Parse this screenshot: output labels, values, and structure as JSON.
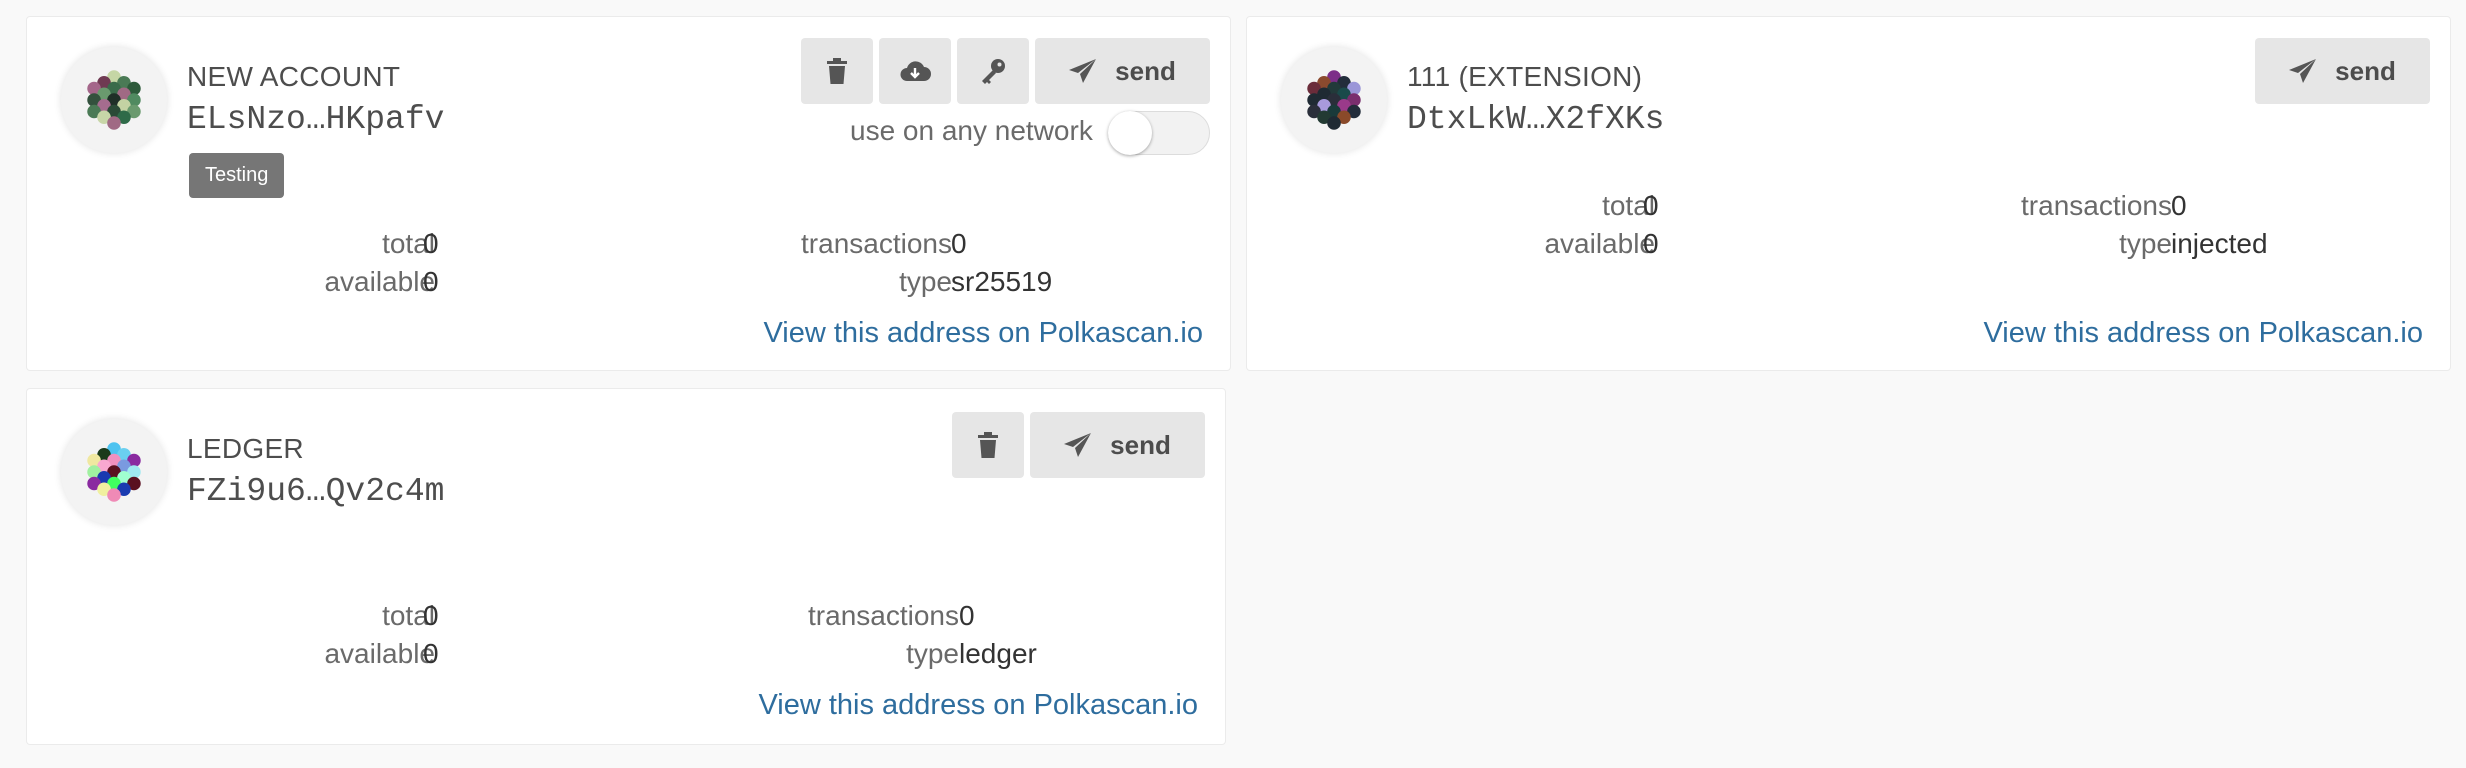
{
  "accounts": [
    {
      "name": "NEW ACCOUNT",
      "address": "ELsNzo…HKpafv",
      "tag": "Testing",
      "network_toggle_label": "use on any network",
      "network_toggle_on": false,
      "send_label": "send",
      "stats": {
        "total_label": "total",
        "total_value": "0",
        "available_label": "available",
        "available_value": "0",
        "transactions_label": "transactions",
        "transactions_value": "0",
        "type_label": "type",
        "type_value": "sr25519"
      },
      "link": "View this address on Polkascan.io",
      "identicon_colors": [
        "#c5d6a5",
        "#6f3a52",
        "#4a7a55",
        "#a4668a",
        "#3a6b4a",
        "#2d5a3a",
        "#6a9a6e",
        "#a06a84",
        "#33513d",
        "#1f2f27",
        "#508a60",
        "#a56c8e",
        "#c3d2a3",
        "#4a7a55",
        "#2a4a36",
        "#6a9a6e",
        "#c8d6a8",
        "#2e6a48",
        "#a06a84"
      ]
    },
    {
      "name": "111 (EXTENSION)",
      "address": "DtxLkW…X2fXKs",
      "send_label": "send",
      "stats": {
        "total_label": "total",
        "total_value": "0",
        "available_label": "available",
        "available_value": "0",
        "transactions_label": "transactions",
        "transactions_value": "0",
        "type_label": "type",
        "type_value": "injected"
      },
      "link": "View this address on Polkascan.io",
      "identicon_colors": [
        "#7c2e88",
        "#8b4a2e",
        "#222c3a",
        "#6a2c3a",
        "#223a3a",
        "#9a96d8",
        "#1f2a33",
        "#1a4a4a",
        "#1f2a33",
        "#2a2e3a",
        "#7a2e6e",
        "#a89adc",
        "#9a3a8a",
        "#2a2e3a",
        "#1a3a3a",
        "#222c3a",
        "#233a33",
        "#8a4a2a",
        "#1f2a33"
      ]
    },
    {
      "name": "LEDGER",
      "address": "FZi9u6…Qv2c4m",
      "send_label": "send",
      "stats": {
        "total_label": "total",
        "total_value": "0",
        "available_label": "available",
        "available_value": "0",
        "transactions_label": "transactions",
        "transactions_value": "0",
        "type_label": "type",
        "type_value": "ledger"
      },
      "link": "View this address on Polkascan.io",
      "identicon_colors": [
        "#4dc3f0",
        "#1a3a1a",
        "#6ad0f0",
        "#f0e8a0",
        "#f090c0",
        "#8a2aa0",
        "#f8a8d0",
        "#7a9ae0",
        "#a0f0a0",
        "#5a1020",
        "#9fe8f0",
        "#1a3ab0",
        "#a0ffd0",
        "#8a2aa0",
        "#40ff60",
        "#5a1020",
        "#f0f0a0",
        "#1a3ab0",
        "#ef8ab6"
      ]
    }
  ]
}
